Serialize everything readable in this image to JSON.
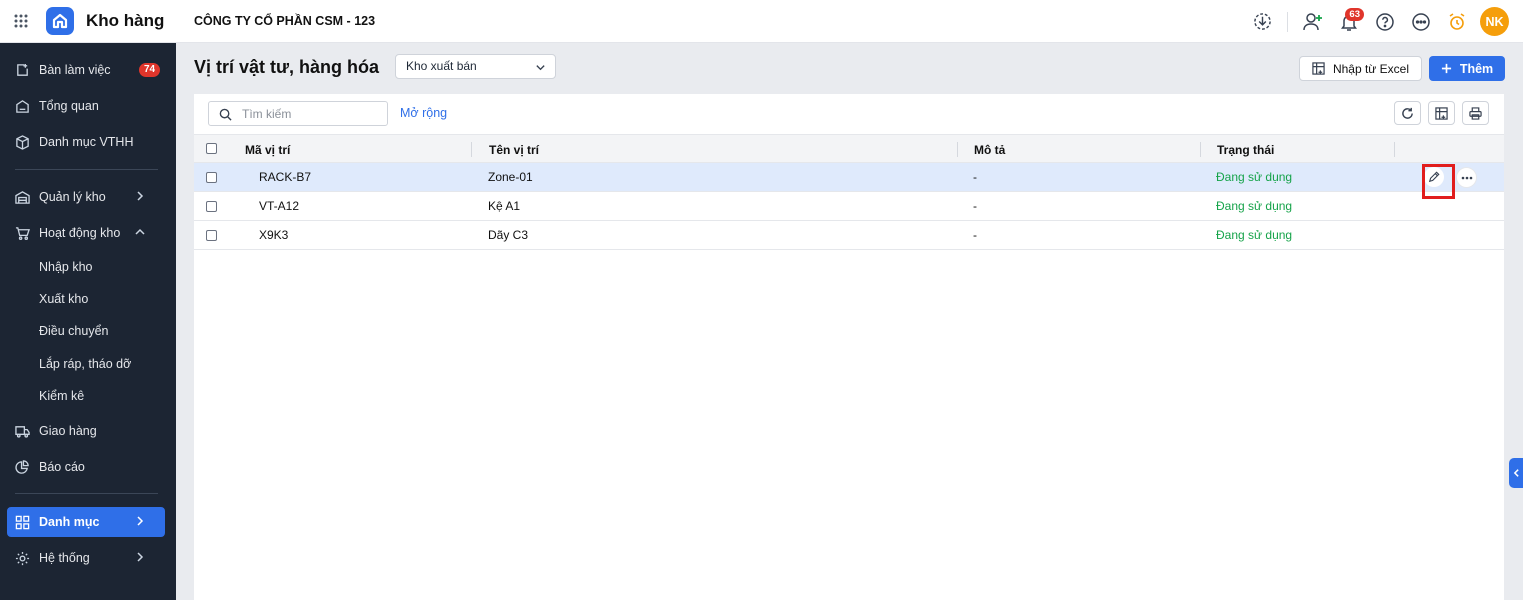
{
  "app": {
    "title": "Kho hàng",
    "company": "CÔNG TY CỔ PHẦN CSM - 123",
    "notification_count": "63",
    "avatar_initials": "NK",
    "accent_color": "#2f6fe8"
  },
  "sidebar": {
    "workspace": {
      "label": "Bàn làm việc",
      "badge": "74"
    },
    "overview": "Tổng quan",
    "catalog_vthh": "Danh mục VTHH",
    "warehouse_mgmt": "Quản lý kho",
    "warehouse_ops": "Hoạt động kho",
    "sub_items": [
      "Nhập kho",
      "Xuất kho",
      "Điều chuyển",
      "Lắp ráp, tháo dỡ",
      "Kiểm kê"
    ],
    "delivery": "Giao hàng",
    "reports": "Báo cáo",
    "catalog": "Danh mục",
    "system": "Hệ thống"
  },
  "page": {
    "title": "Vị trí vật tư, hàng hóa",
    "warehouse_select": "Kho xuất bán",
    "import_excel": "Nhập từ Excel",
    "add": "Thêm"
  },
  "toolbar": {
    "search_placeholder": "Tìm kiếm",
    "expand": "Mở rộng"
  },
  "table": {
    "headers": {
      "code": "Mã vị trí",
      "name": "Tên vị trí",
      "desc": "Mô tả",
      "status": "Trạng thái"
    },
    "rows": [
      {
        "code": "RACK-B7",
        "name": "Zone-01",
        "desc": "-",
        "status": "Đang sử dụng",
        "selected": true
      },
      {
        "code": "VT-A12",
        "name": "Kệ A1",
        "desc": "-",
        "status": "Đang sử dụng",
        "selected": false
      },
      {
        "code": "X9K3",
        "name": "Dãy C3",
        "desc": "-",
        "status": "Đang sử dụng",
        "selected": false
      }
    ]
  }
}
